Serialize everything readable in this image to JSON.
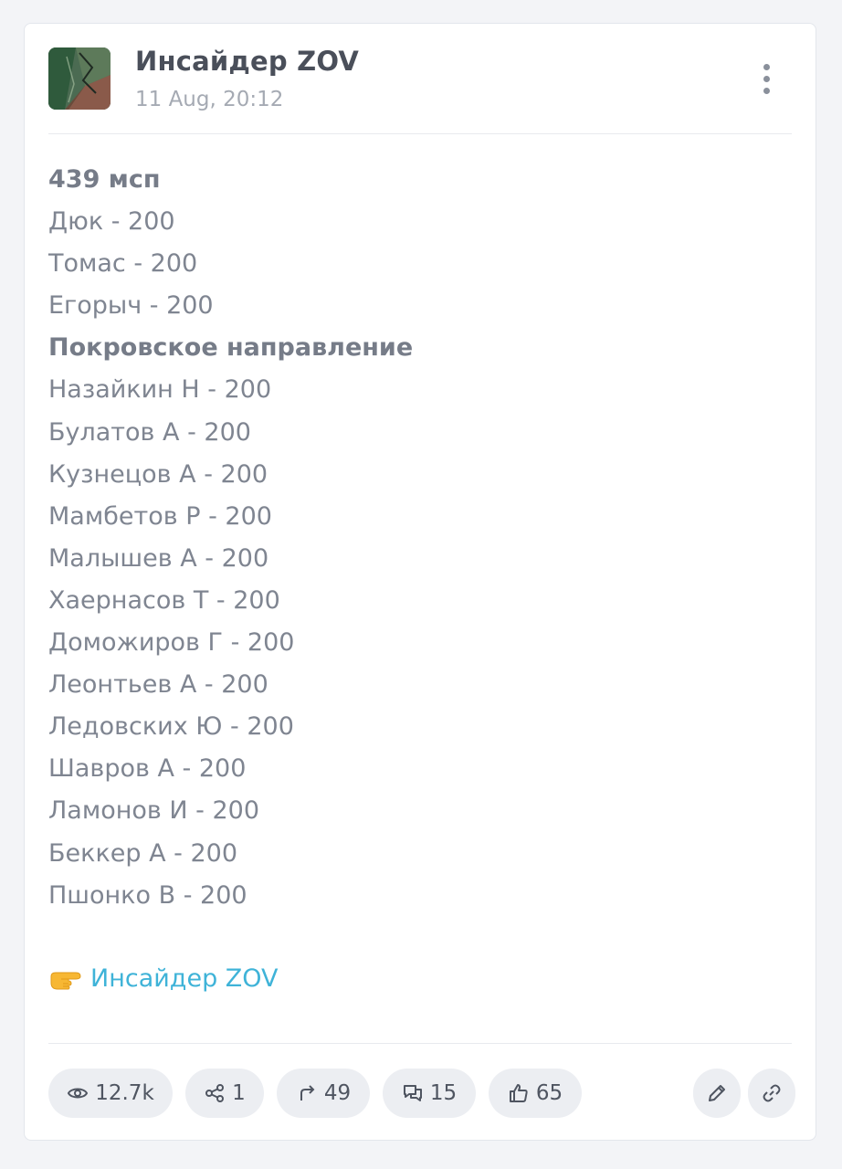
{
  "header": {
    "channel_name": "Инсайдер ZOV",
    "date": "11 Aug, 20:12"
  },
  "post": {
    "lines": [
      {
        "text": "439 мсп",
        "bold": true
      },
      {
        "text": "Дюк - 200",
        "bold": false
      },
      {
        "text": "Томас - 200",
        "bold": false
      },
      {
        "text": "Егорыч - 200",
        "bold": false
      },
      {
        "text": "Покровское направление",
        "bold": true
      },
      {
        "text": "Назайкин Н - 200",
        "bold": false
      },
      {
        "text": "Булатов А - 200",
        "bold": false
      },
      {
        "text": "Кузнецов А - 200",
        "bold": false
      },
      {
        "text": "Мамбетов Р - 200",
        "bold": false
      },
      {
        "text": "Малышев А - 200",
        "bold": false
      },
      {
        "text": "Хаернасов Т - 200",
        "bold": false
      },
      {
        "text": "Доможиров Г - 200",
        "bold": false
      },
      {
        "text": "Леонтьев А - 200",
        "bold": false
      },
      {
        "text": "Ледовских Ю - 200",
        "bold": false
      },
      {
        "text": "Шавров А - 200",
        "bold": false
      },
      {
        "text": "Ламонов И - 200",
        "bold": false
      },
      {
        "text": "Беккер А - 200",
        "bold": false
      },
      {
        "text": "Пшонко В - 200",
        "bold": false
      }
    ],
    "signature": {
      "emoji_icon": "pointing-hand-icon",
      "link_text": "Инсайдер ZOV"
    }
  },
  "stats": {
    "views": "12.7k",
    "shares": "1",
    "forwards": "49",
    "comments": "15",
    "reactions": "65"
  },
  "colors": {
    "link": "#3fb3d8",
    "text": "#7f8591",
    "pill_background": "#eceef2"
  }
}
